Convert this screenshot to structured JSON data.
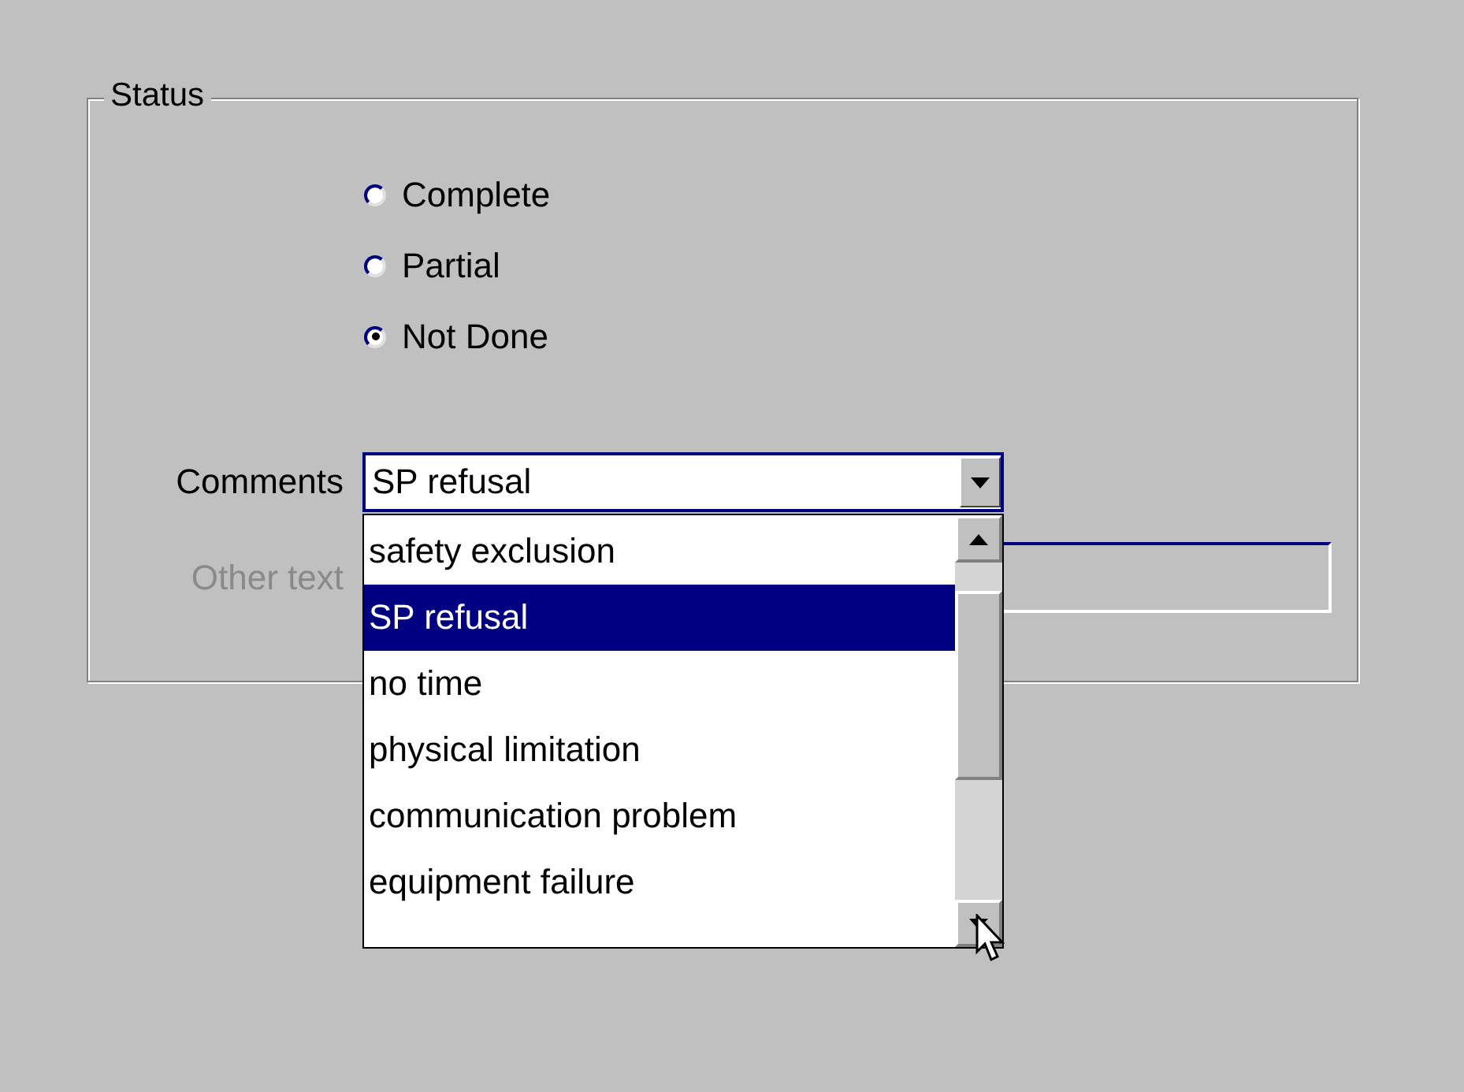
{
  "status_group": {
    "title": "Status"
  },
  "status_options": [
    {
      "label": "Complete",
      "selected": false
    },
    {
      "label": "Partial",
      "selected": false
    },
    {
      "label": "Not Done",
      "selected": true
    }
  ],
  "comments": {
    "label": "Comments",
    "value": "SP refusal",
    "expanded": true
  },
  "other_text": {
    "label": "Other text",
    "disabled": true
  },
  "dropdown_items": [
    {
      "label": "safety exclusion",
      "selected": false
    },
    {
      "label": "SP refusal",
      "selected": true
    },
    {
      "label": "no time",
      "selected": false
    },
    {
      "label": "physical limitation",
      "selected": false
    },
    {
      "label": "communication problem",
      "selected": false
    },
    {
      "label": "equipment failure",
      "selected": false
    }
  ]
}
